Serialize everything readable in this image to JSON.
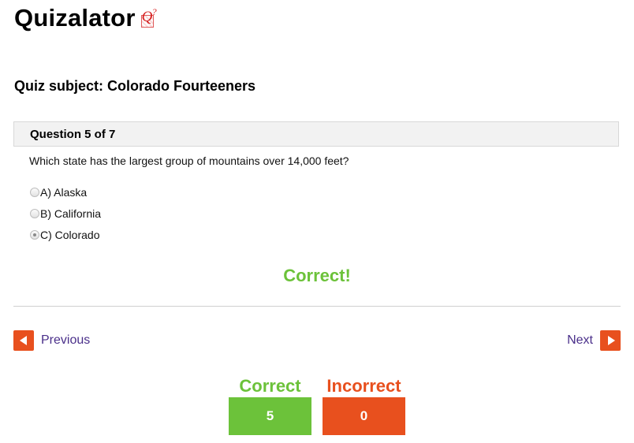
{
  "app": {
    "title": "Quizalator",
    "logo_icon": "q-question-logo-icon",
    "logo_letter": "Q",
    "logo_mark": "?"
  },
  "quiz": {
    "subject": "Quiz subject: Colorado Fourteeners",
    "question_counter": "Question 5 of 7",
    "question_text": "Which state has the largest group of mountains over 14,000 feet?",
    "options": [
      {
        "label": "A) Alaska",
        "selected": false
      },
      {
        "label": "B) California",
        "selected": false
      },
      {
        "label": "C) Colorado",
        "selected": true
      }
    ],
    "feedback": "Correct!"
  },
  "nav": {
    "previous_label": "Previous",
    "next_label": "Next",
    "previous_icon": "arrow-left-icon",
    "next_icon": "arrow-right-icon"
  },
  "score": {
    "correct_label": "Correct",
    "correct_value": "5",
    "incorrect_label": "Incorrect",
    "incorrect_value": "0"
  },
  "colors": {
    "correct": "#6cc23a",
    "incorrect": "#e8501e",
    "nav_link": "#4a2f8a",
    "logo": "#d62222"
  }
}
